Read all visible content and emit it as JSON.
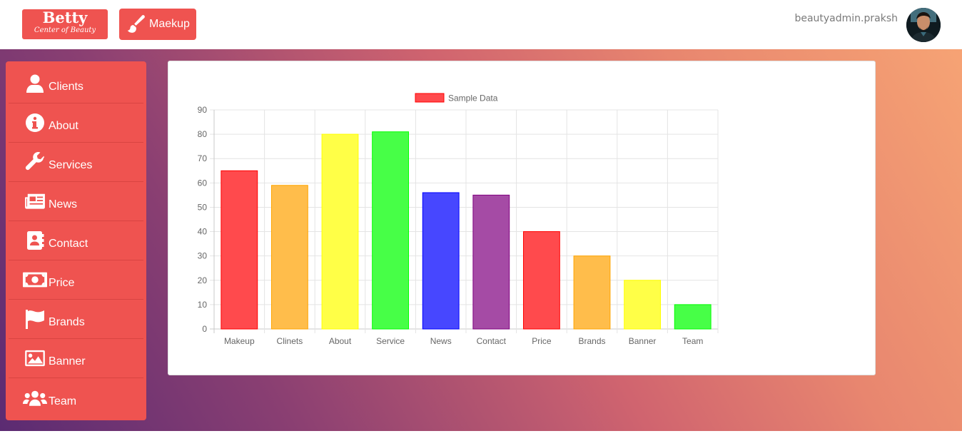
{
  "header": {
    "brand_title": "Betty",
    "brand_subtitle": "Center of Beauty",
    "makeup_label": "Maekup",
    "username": "beautyadmin.praksh"
  },
  "sidebar": {
    "items": [
      {
        "label": "Clients",
        "icon": "user-icon"
      },
      {
        "label": "About",
        "icon": "info-icon"
      },
      {
        "label": "Services",
        "icon": "wrench-icon"
      },
      {
        "label": "News",
        "icon": "newspaper-icon"
      },
      {
        "label": "Contact",
        "icon": "address-book-icon"
      },
      {
        "label": "Price",
        "icon": "money-bill-icon"
      },
      {
        "label": "Brands",
        "icon": "flag-icon"
      },
      {
        "label": "Banner",
        "icon": "image-icon"
      },
      {
        "label": "Team",
        "icon": "users-icon"
      }
    ]
  },
  "colors": {
    "accent": "#ef5350"
  },
  "chart_data": {
    "type": "bar",
    "categories": [
      "Makeup",
      "Clinets",
      "About",
      "Service",
      "News",
      "Contact",
      "Price",
      "Brands",
      "Banner",
      "Team"
    ],
    "series": [
      {
        "name": "Sample Data",
        "values": [
          65,
          59,
          80,
          81,
          56,
          55,
          40,
          30,
          20,
          10
        ]
      }
    ],
    "bar_colors": [
      "#ff4a4d",
      "#ffbd4b",
      "#ffff47",
      "#47ff47",
      "#4747ff",
      "#a54ba5",
      "#ff4a4d",
      "#ffbd4b",
      "#ffff47",
      "#47ff47"
    ],
    "bar_borders": [
      "#ff0000",
      "#ffa500",
      "#ffff00",
      "#00ff00",
      "#0000ff",
      "#800080",
      "#ff0000",
      "#ffa500",
      "#ffff00",
      "#00ff00"
    ],
    "ylim": [
      0,
      90
    ],
    "yticks": [
      0,
      10,
      20,
      30,
      40,
      50,
      60,
      70,
      80,
      90
    ],
    "grid": true,
    "legend_position": "top"
  }
}
